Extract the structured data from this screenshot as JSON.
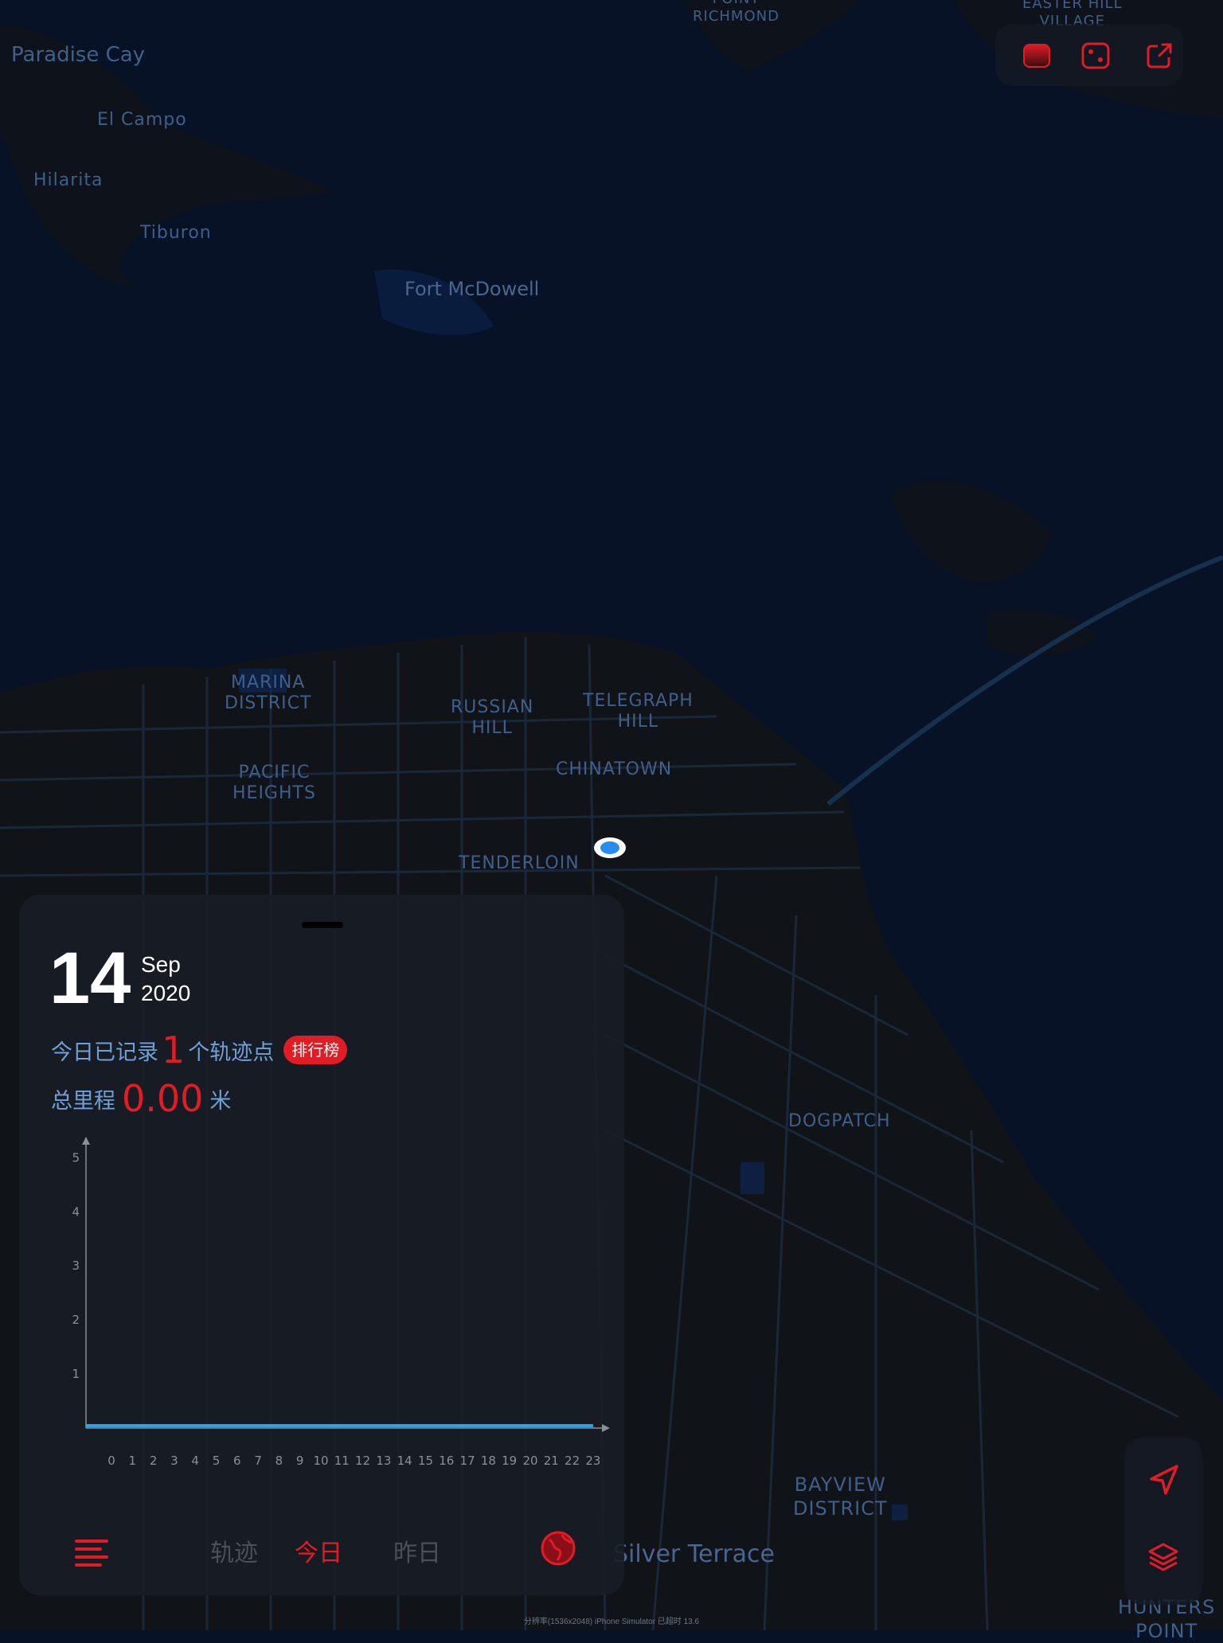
{
  "map": {
    "labels": [
      {
        "id": "paradise-cay",
        "text": "Paradise Cay"
      },
      {
        "id": "el-campo",
        "text": "El Campo"
      },
      {
        "id": "hilarita",
        "text": "Hilarita"
      },
      {
        "id": "tiburon",
        "text": "Tiburon"
      },
      {
        "id": "fort-mcdowell",
        "text": "Fort McDowell"
      },
      {
        "id": "point-richmond",
        "text": "POINT\nRICHMOND"
      },
      {
        "id": "easter-hill",
        "text": "EASTER HILL\nVILLAGE"
      },
      {
        "id": "marina",
        "text": "MARINA\nDISTRICT"
      },
      {
        "id": "russian-hill",
        "text": "RUSSIAN\nHILL"
      },
      {
        "id": "telegraph-hill",
        "text": "TELEGRAPH\nHILL"
      },
      {
        "id": "pacific-heights",
        "text": "PACIFIC\nHEIGHTS"
      },
      {
        "id": "chinatown",
        "text": "CHINATOWN"
      },
      {
        "id": "tenderloin",
        "text": "TENDERLOIN"
      },
      {
        "id": "dogpatch",
        "text": "DOGPATCH"
      },
      {
        "id": "bayview",
        "text": "BAYVIEW\nDISTRICT"
      },
      {
        "id": "silver-terrace",
        "text": "Silver Terrace"
      },
      {
        "id": "hunters-point",
        "text": "HUNTERS\nPOINT"
      }
    ]
  },
  "summary": {
    "day": "14",
    "month": "Sep",
    "year": "2020",
    "recorded_prefix": "今日已记录",
    "point_count": "1",
    "recorded_suffix": "个轨迹点",
    "ranking_label": "排行榜",
    "distance_label": "总里程",
    "distance_value": "0.00",
    "distance_unit": "米"
  },
  "tabs": {
    "track": "轨迹",
    "today": "今日",
    "yesterday": "昨日",
    "active": "today"
  },
  "footer": "分辨率(1536x2048)  iPhone Simulator  已超时 13.6",
  "colors": {
    "accent": "#e01c24",
    "text_blue": "#6fa0d8",
    "line": "#2aa3e8",
    "map_bg": "#071226"
  },
  "chart_data": {
    "type": "line",
    "x": [
      0,
      1,
      2,
      3,
      4,
      5,
      6,
      7,
      8,
      9,
      10,
      11,
      12,
      13,
      14,
      15,
      16,
      17,
      18,
      19,
      20,
      21,
      22,
      23
    ],
    "series": [
      {
        "values": [
          0,
          0,
          0,
          0,
          0,
          0,
          0,
          0,
          0,
          0,
          0,
          0,
          0,
          0,
          0,
          0,
          0,
          0,
          0,
          0,
          0,
          0,
          0,
          0
        ]
      }
    ],
    "yticks": [
      1,
      2,
      3,
      4,
      5
    ],
    "ylim": [
      0,
      5.3
    ],
    "xlabel": "",
    "ylabel": "",
    "grid": false
  }
}
